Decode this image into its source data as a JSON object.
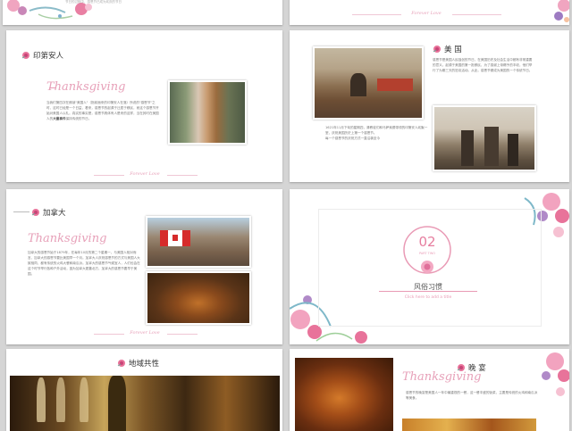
{
  "slides": {
    "top_left": {
      "line_text": "节日的过程中，感恩节已成为欢庆的节日"
    },
    "top_right": {
      "footer": "Forever Love"
    },
    "indians": {
      "title": "印第安人",
      "thanks": "Thanksgiving",
      "body_1": "当我们第四次在朗读\"美国人\"（指前面来的印第安人在落）所说的\"感恩节\"之时，这时已经是一个日益，看来，感恩节的起源于迁居于移民，而这个感恩节开始对美国人以礼。",
      "body_2": "真实的事实是，感恩节具体有人是来的这样，当在其时在美国人的",
      "body_bold": "大量事件",
      "body_3": "保持传统的节日。",
      "footer": "Forever Love"
    },
    "usa": {
      "title": "美 国",
      "body_right": "感恩节是美国人民独创的节日，在美国历史及社会生活中都有非常重要的意义。起源于美国的第一批移民，为了感谢上帝赐予的丰收，他们举行了为期三天的狂欢活动。从此，感恩节便成为美国的一个传统节日。",
      "body_left_1": "1621年11月下旬的星期四，清教徒们和马萨索德带领的印第安人欢聚一堂，庆祝美国历史上第一个感恩节。",
      "body_left_2": "每一个感恩节的庆祝方式一直沿袭至今"
    },
    "canada": {
      "title": "加拿大",
      "thanks": "Thanksgiving",
      "body": "加拿大的感恩节始于1879年，在每年10月的第二个星期一，与美国人相对而言，加拿大的感恩节要比美国早一个月。加拿大人庆祝感恩节的方式与美国人大致相同，都有传统的火鸡大餐和南瓜派。加拿大的感恩节气候宜人，人们也会在这个时节举行各种户外活动，因为加拿大更靠北方，加拿大的感恩节要早于美国。",
      "footer": "Forever Love"
    },
    "section": {
      "number": "02",
      "part": "PART TWO",
      "heading": "风俗习惯",
      "sub": "Click here to add a title"
    },
    "common": {
      "title": "地域共性"
    },
    "dinner": {
      "title": "晚 宴",
      "thanks": "Thanksgiving",
      "body": "感恩节的晚宴是美国人一年中最重视的一餐，这一餐丰盛的饭菜，主要是传统的火鸡和南瓜派等美食。"
    }
  },
  "colors": {
    "accent_pink": "#e99ab5",
    "background": "#d5d5d5"
  }
}
